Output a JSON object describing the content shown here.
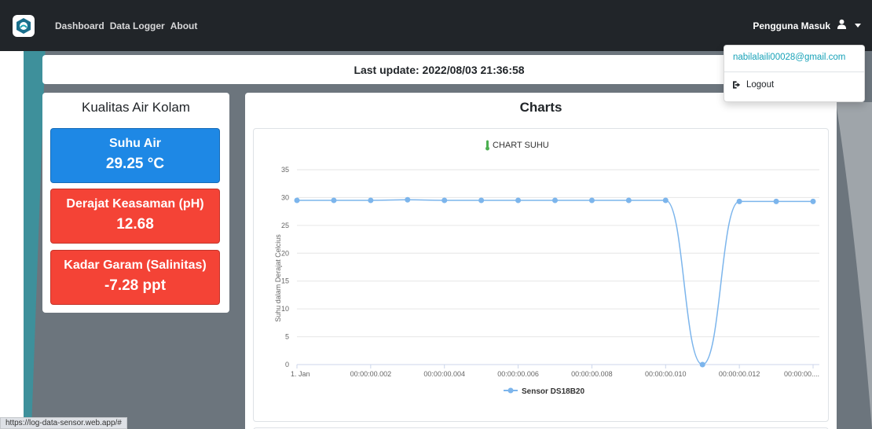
{
  "nav": {
    "links": [
      "Dashboard",
      "Data Logger",
      "About"
    ],
    "user_label": "Pengguna Masuk"
  },
  "dropdown": {
    "email": "nabilalaili00028@gmail.com",
    "logout": "Logout"
  },
  "update": {
    "text": "Last update: 2022/08/03 21:36:58"
  },
  "quality": {
    "title": "Kualitas Air Kolam",
    "metrics": [
      {
        "label": "Suhu Air",
        "value": "29.25 °C",
        "color": "#1e88e5"
      },
      {
        "label": "Derajat Keasaman (pH)",
        "value": "12.68",
        "color": "#f44336"
      },
      {
        "label": "Kadar Garam (Salinitas)",
        "value": "-7.28 ppt",
        "color": "#f44336"
      }
    ]
  },
  "charts": {
    "title": "Charts"
  },
  "status_url": "https://log-data-sensor.web.app/#",
  "chart_data": {
    "type": "line",
    "title": "CHART SUHU",
    "ylabel": "Suhu dalam Derajat Celcius",
    "xlabel": "",
    "ylim": [
      0,
      35
    ],
    "yticks": [
      0,
      5,
      10,
      15,
      20,
      25,
      30,
      35
    ],
    "x_tick_labels": [
      "1. Jan",
      "00:00:00.002",
      "00:00:00.004",
      "00:00:00.006",
      "00:00:00.008",
      "00:00:00.010",
      "00:00:00.012",
      "00:00:00...."
    ],
    "grid": true,
    "legend": "bottom-center",
    "series": [
      {
        "name": "Sensor DS18B20",
        "color": "#7cb5ec",
        "values": [
          29.5,
          29.5,
          29.5,
          29.6,
          29.5,
          29.5,
          29.5,
          29.5,
          29.5,
          29.5,
          29.5,
          0,
          29.3,
          29.3,
          29.3
        ]
      }
    ]
  }
}
